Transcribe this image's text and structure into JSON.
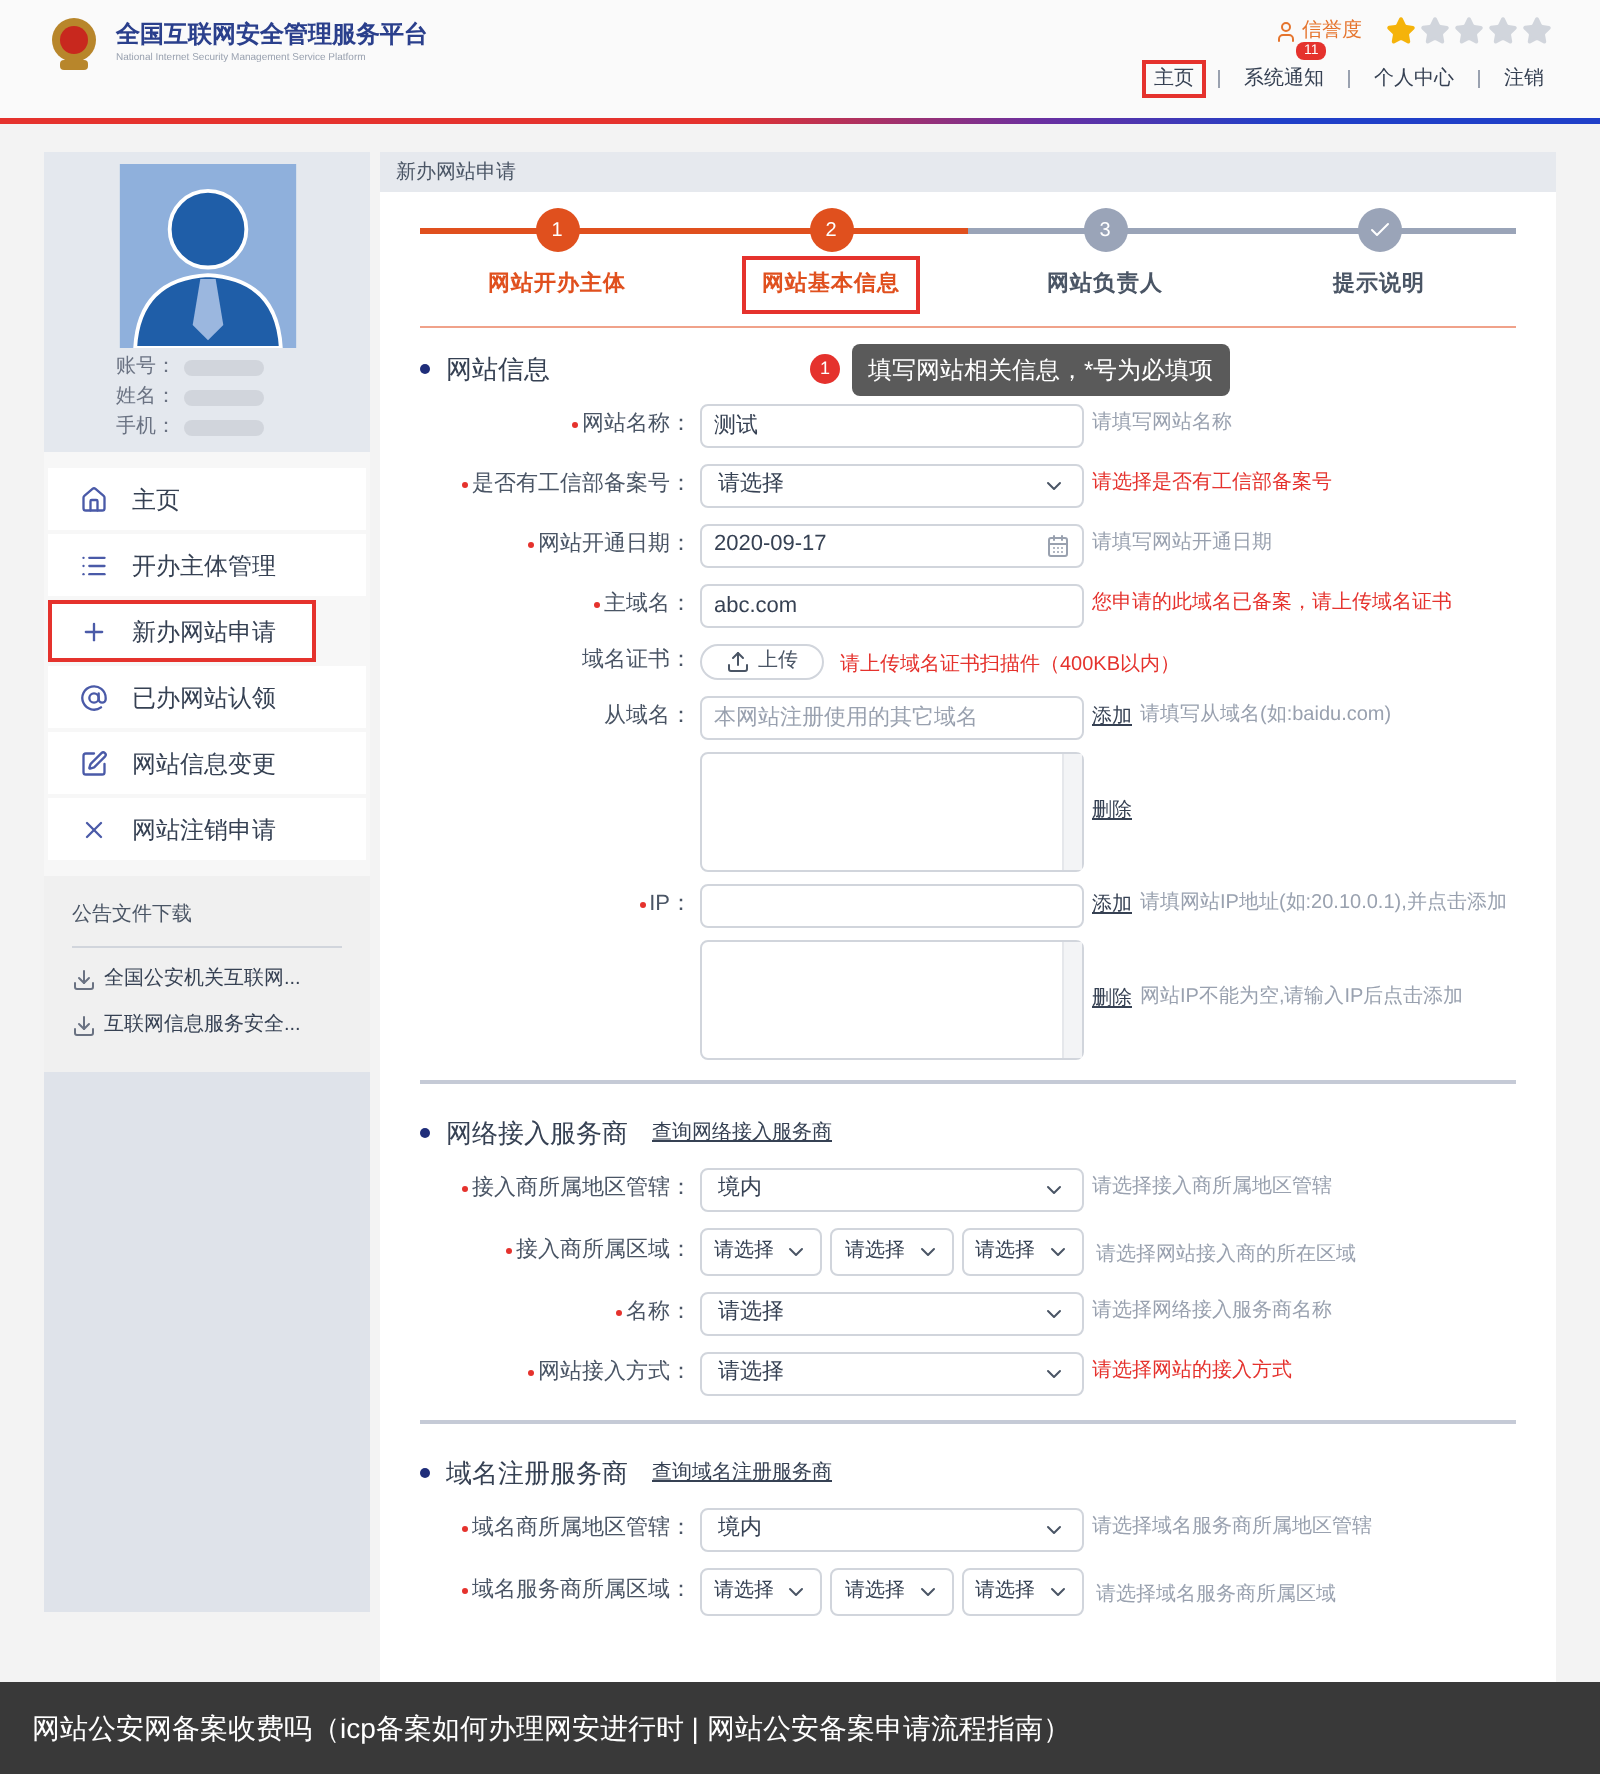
{
  "header": {
    "title": "全国互联网安全管理服务平台",
    "subtitle": "National Internet Security Management Service Platform",
    "credit_label": "信誉度",
    "stars": 1,
    "notification_count": "11",
    "nav": [
      {
        "label": "主页",
        "highlighted": true
      },
      {
        "label": "系统通知",
        "highlighted": false
      },
      {
        "label": "个人中心",
        "highlighted": false
      },
      {
        "label": "注销",
        "highlighted": false
      }
    ]
  },
  "profile": {
    "fields": [
      "账号：",
      "姓名：",
      "手机："
    ]
  },
  "sidebar": {
    "items": [
      {
        "label": "主页",
        "highlighted": false
      },
      {
        "label": "开办主体管理",
        "highlighted": false
      },
      {
        "label": "新办网站申请",
        "highlighted": true
      },
      {
        "label": "已办网站认领",
        "highlighted": false
      },
      {
        "label": "网站信息变更",
        "highlighted": false
      },
      {
        "label": "网站注销申请",
        "highlighted": false
      }
    ],
    "downloads_title": "公告文件下载",
    "downloads": [
      "全国公安机关互联网...",
      "互联网信息服务安全..."
    ]
  },
  "panel": {
    "title": "新办网站申请",
    "steps": [
      {
        "kind": "number",
        "marker": "1",
        "label": "网站开办主体",
        "reached": true,
        "highlighted": false
      },
      {
        "kind": "number",
        "marker": "2",
        "label": "网站基本信息",
        "reached": true,
        "highlighted": true
      },
      {
        "kind": "number",
        "marker": "3",
        "label": "网站负责人",
        "reached": false,
        "highlighted": false
      },
      {
        "kind": "check",
        "label": "提示说明",
        "reached": false,
        "highlighted": false
      }
    ],
    "sections": [
      {
        "title": "网站信息",
        "tip_badge": "1",
        "tip": "填写网站相关信息，*号为必填项",
        "rows": [
          {
            "kind": "input",
            "label": "网站名称：",
            "required": true,
            "value": "测试",
            "hint": "请填写网站名称",
            "alert": false
          },
          {
            "kind": "select",
            "label": "是否有工信部备案号：",
            "required": true,
            "value": "请选择",
            "hint": "请选择是否有工信部备案号",
            "alert": true
          },
          {
            "kind": "date",
            "label": "网站开通日期：",
            "required": true,
            "value": "2020-09-17",
            "hint": "请填写网站开通日期",
            "alert": false
          },
          {
            "kind": "input",
            "label": "主域名：",
            "required": true,
            "value": "abc.com",
            "hint": "您申请的此域名已备案，请上传域名证书",
            "alert": true
          },
          {
            "kind": "upload",
            "label": "域名证书：",
            "required": false,
            "value": "上传",
            "hint": "请上传域名证书扫描件（400KB以内）",
            "alert": true
          },
          {
            "kind": "input",
            "label": "从域名：",
            "required": false,
            "placeholder": "本网站注册使用的其它域名",
            "link": "添加",
            "hint": "请填写从域名(如:baidu.com)",
            "alert": false
          },
          {
            "kind": "textarea",
            "link": "删除"
          },
          {
            "kind": "input",
            "label": "IP：",
            "required": true,
            "link": "添加",
            "hint": "请填网站IP地址(如:20.10.0.1),并点击添加",
            "alert": false
          },
          {
            "kind": "textarea",
            "link": "删除",
            "hint": "网站IP不能为空,请输入IP后点击添加",
            "alert": false
          }
        ]
      },
      {
        "title": "网络接入服务商",
        "link": "查询网络接入服务商",
        "rows": [
          {
            "kind": "select",
            "label": "接入商所属地区管辖：",
            "required": true,
            "value": "境内",
            "hint": "请选择接入商所属地区管辖",
            "alert": false
          },
          {
            "kind": "selects",
            "label": "接入商所属区域：",
            "required": true,
            "values": [
              "请选择",
              "请选择",
              "请选择"
            ],
            "hint": "请选择网站接入商的所在区域",
            "alert": false
          },
          {
            "kind": "select",
            "label": "名称：",
            "required": true,
            "value": "请选择",
            "hint": "请选择网络接入服务商名称",
            "alert": false
          },
          {
            "kind": "select",
            "label": "网站接入方式：",
            "required": true,
            "value": "请选择",
            "hint": "请选择网站的接入方式",
            "alert": true
          }
        ]
      },
      {
        "title": "域名注册服务商",
        "link": "查询域名注册服务商",
        "rows": [
          {
            "kind": "select",
            "label": "域名商所属地区管辖：",
            "required": true,
            "value": "境内",
            "hint": "请选择域名服务商所属地区管辖",
            "alert": false
          },
          {
            "kind": "selects",
            "label": "域名服务商所属区域：",
            "required": true,
            "values": [
              "请选择",
              "请选择",
              "请选择"
            ],
            "hint": "请选择域名服务商所属区域",
            "alert": false
          }
        ]
      }
    ]
  },
  "caption": "网站公安网备案收费吗（icp备案如何办理网安进行时 | 网站公安备案申请流程指南）"
}
